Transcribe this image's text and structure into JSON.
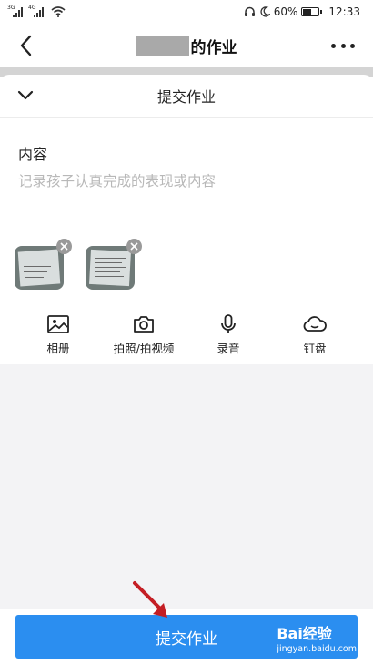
{
  "status_bar": {
    "signal_1": "3G",
    "signal_2": "4G",
    "battery": "60%",
    "battery_level": 0.6,
    "time": "12:33"
  },
  "nav": {
    "title_suffix": "的作业"
  },
  "sheet": {
    "title": "提交作业"
  },
  "content": {
    "label": "内容",
    "placeholder": "记录孩子认真完成的表现或内容"
  },
  "tools": [
    {
      "label": "相册",
      "icon": "image-icon"
    },
    {
      "label": "拍照/拍视频",
      "icon": "camera-icon"
    },
    {
      "label": "录音",
      "icon": "microphone-icon"
    },
    {
      "label": "钉盘",
      "icon": "cloud-icon"
    }
  ],
  "submit_label": "提交作业",
  "watermark": {
    "brand": "Bai经验",
    "url": "jingyan.baidu.com"
  },
  "colors": {
    "primary": "#2b8ef0",
    "arrow": "#c41e24",
    "page_gray": "#f3f3f5"
  }
}
